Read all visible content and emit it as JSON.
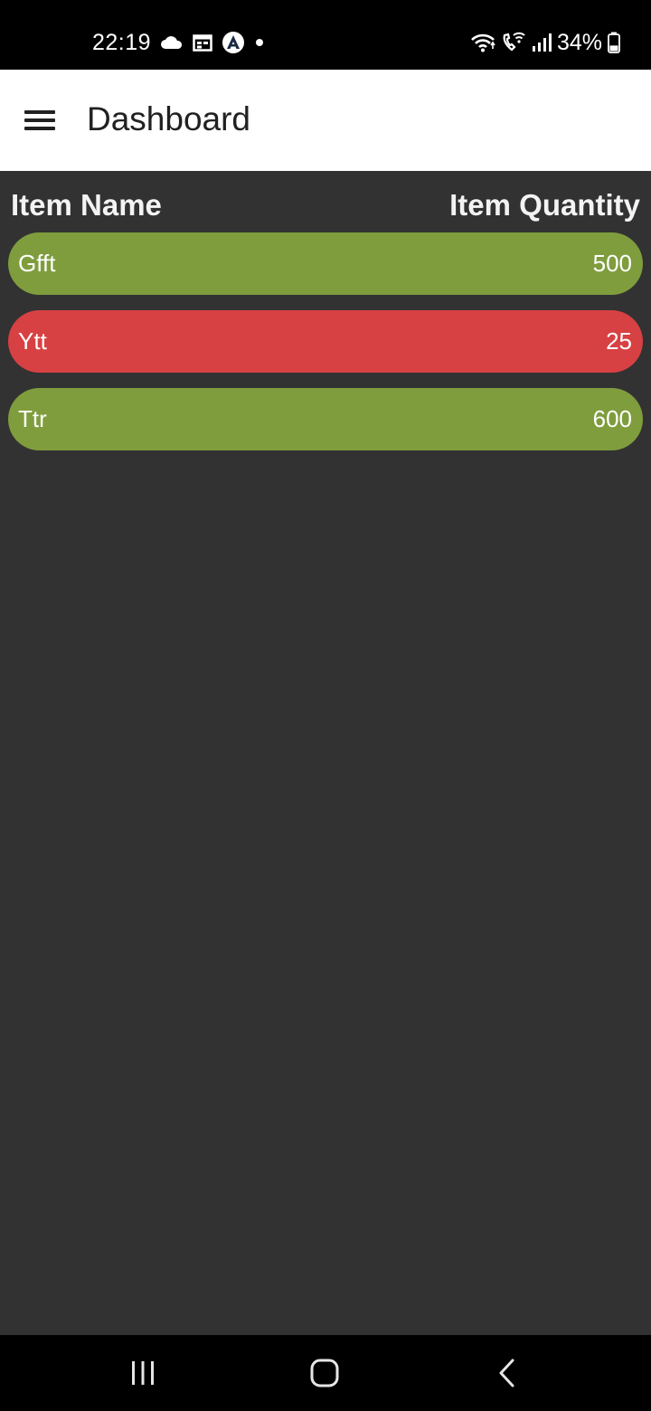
{
  "status_bar": {
    "time": "22:19",
    "battery_percent": "34%",
    "left_icons": [
      "cloud-icon",
      "calendar-icon",
      "arc-app-icon",
      "notification-dot-icon"
    ],
    "right_icons": [
      "wifi-icon",
      "wifi-call-icon",
      "signal-icon",
      "battery-icon"
    ],
    "battery_level": 0.34
  },
  "app_bar": {
    "title": "Dashboard",
    "menu_icon": "hamburger-menu-icon"
  },
  "table": {
    "header_name": "Item Name",
    "header_quantity": "Item Quantity",
    "rows": [
      {
        "name": "Gfft",
        "quantity": "500",
        "status_color": "#7f9d3d"
      },
      {
        "name": "Ytt",
        "quantity": "25",
        "status_color": "#d74143"
      },
      {
        "name": "Ttr",
        "quantity": "600",
        "status_color": "#7f9d3d"
      }
    ]
  },
  "colors": {
    "background": "#323232",
    "app_bar": "#ffffff",
    "ok_green": "#7f9d3d",
    "low_red": "#d74143"
  },
  "nav_bar": {
    "buttons": [
      "recent-apps-icon",
      "home-icon",
      "back-icon"
    ]
  }
}
